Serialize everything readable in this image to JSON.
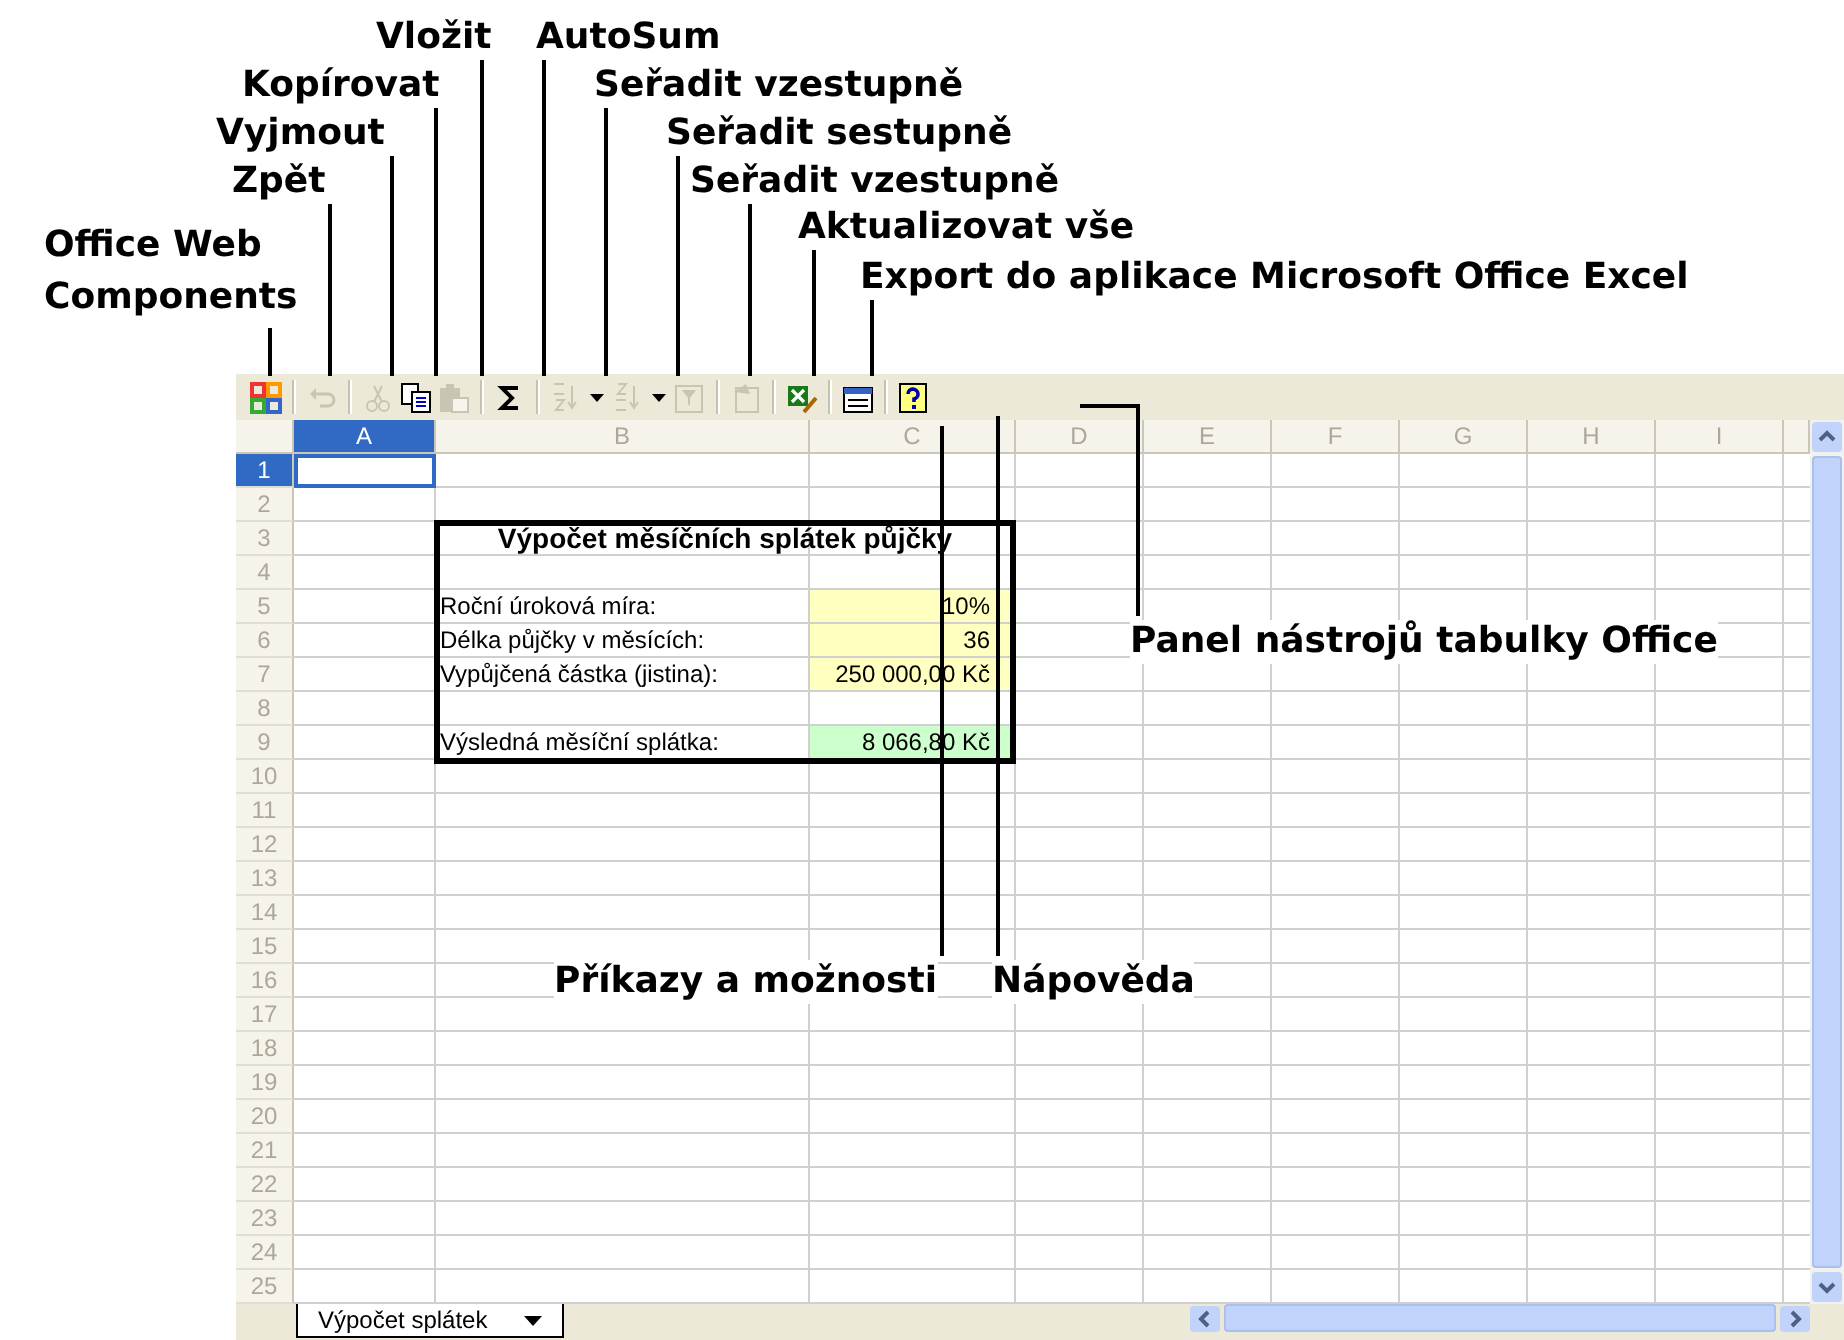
{
  "callouts": [
    {
      "text": "Vložit"
    },
    {
      "text": "AutoSum"
    },
    {
      "text": "Kopírovat"
    },
    {
      "text": "Seřadit vzestupně"
    },
    {
      "text": "Vyjmout"
    },
    {
      "text": "Seřadit sestupně"
    },
    {
      "text": "Zpět"
    },
    {
      "text": "Seřadit vzestupně"
    },
    {
      "text": "Aktualizovat vše"
    },
    {
      "text": "Office Web Components"
    },
    {
      "text": "Export do aplikace Microsoft Office Excel"
    },
    {
      "text": "Panel nástrojů tabulky Office"
    },
    {
      "text": "Příkazy a možnosti"
    },
    {
      "text": "Nápověda"
    }
  ],
  "toolbar": [
    {
      "kind": "office",
      "disabled": false,
      "separator_after": true
    },
    {
      "kind": "undo",
      "disabled": true,
      "separator_after": true
    },
    {
      "kind": "cut",
      "disabled": true,
      "separator_after": false
    },
    {
      "kind": "copy",
      "disabled": false,
      "separator_after": false
    },
    {
      "kind": "paste",
      "disabled": true,
      "separator_after": true
    },
    {
      "kind": "autosum",
      "disabled": false,
      "separator_after": true
    },
    {
      "kind": "sort-asc",
      "disabled": true,
      "dropdown": true,
      "separator_after": false
    },
    {
      "kind": "sort-desc",
      "disabled": true,
      "dropdown": true,
      "separator_after": false
    },
    {
      "kind": "filter",
      "disabled": true,
      "separator_after": true
    },
    {
      "kind": "refresh",
      "disabled": true,
      "separator_after": true
    },
    {
      "kind": "export",
      "disabled": false,
      "separator_after": true
    },
    {
      "kind": "commands",
      "disabled": false,
      "separator_after": true
    },
    {
      "kind": "help",
      "disabled": false,
      "separator_after": false
    }
  ],
  "columns": [
    {
      "label": "A",
      "selected": true
    },
    {
      "label": "B",
      "selected": false
    },
    {
      "label": "C",
      "selected": false
    },
    {
      "label": "D",
      "selected": false
    },
    {
      "label": "E",
      "selected": false
    },
    {
      "label": "F",
      "selected": false
    },
    {
      "label": "G",
      "selected": false
    },
    {
      "label": "H",
      "selected": false
    },
    {
      "label": "I",
      "selected": false
    }
  ],
  "rows": [
    {
      "label": "1",
      "selected": true
    },
    {
      "label": "2",
      "selected": false
    },
    {
      "label": "3",
      "selected": false,
      "title": "Výpočet měsíčních splátek půjčky"
    },
    {
      "label": "4",
      "selected": false
    },
    {
      "label": "5",
      "selected": false,
      "name": "Roční úroková míra:",
      "value": "10%",
      "color": "#ffffc0"
    },
    {
      "label": "6",
      "selected": false,
      "name": "Délka půjčky v měsících:",
      "value": "36",
      "color": "#ffffc0"
    },
    {
      "label": "7",
      "selected": false,
      "name": "Vypůjčená částka (jistina):",
      "value": "250 000,00 Kč",
      "color": "#ffffc0"
    },
    {
      "label": "8",
      "selected": false
    },
    {
      "label": "9",
      "selected": false,
      "name": "Výsledná měsíční splátka:",
      "value": "8 066,80 Kč",
      "color": "#ccffcc"
    },
    {
      "label": "10",
      "selected": false
    },
    {
      "label": "11",
      "selected": false
    },
    {
      "label": "12",
      "selected": false
    },
    {
      "label": "13",
      "selected": false
    },
    {
      "label": "14",
      "selected": false
    },
    {
      "label": "15",
      "selected": false
    },
    {
      "label": "16",
      "selected": false
    },
    {
      "label": "17",
      "selected": false
    },
    {
      "label": "18",
      "selected": false
    },
    {
      "label": "19",
      "selected": false
    },
    {
      "label": "20",
      "selected": false
    },
    {
      "label": "21",
      "selected": false
    },
    {
      "label": "22",
      "selected": false
    },
    {
      "label": "23",
      "selected": false
    },
    {
      "label": "24",
      "selected": false
    },
    {
      "label": "25",
      "selected": false
    }
  ],
  "sheet_tab": {
    "label": "Výpočet splátek"
  }
}
